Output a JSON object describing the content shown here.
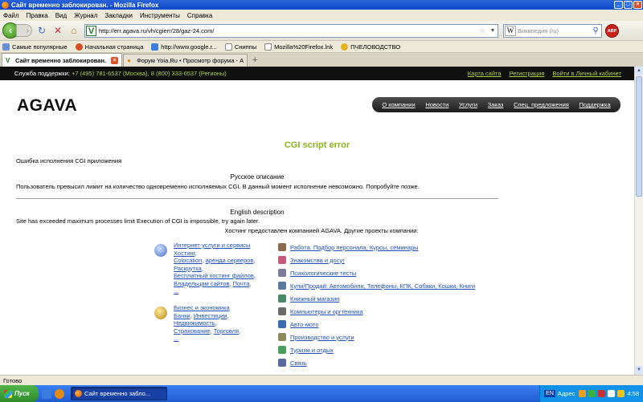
{
  "window": {
    "title": "Сайт временно заблокирован. - Mozilla Firefox"
  },
  "menu": [
    "Файл",
    "Правка",
    "Вид",
    "Журнал",
    "Закладки",
    "Инструменты",
    "Справка"
  ],
  "nav": {
    "url": "http://err.agava.ru/vh/cgierr/28/gaz-24.com/",
    "search_placeholder": "Википедия (ru)",
    "adblock": "ABP"
  },
  "bookmarks": [
    "Самые популярные",
    "Начальная страница",
    "http://www.google.r...",
    "Сниппы",
    "Mozilla%20Firefox.lnk",
    "ПЧЕЛОВОДСТВО"
  ],
  "tabs": [
    {
      "label": "Сайт временно заблокирован.",
      "active": true
    },
    {
      "label": "Форум Yoia.Ru • Просмотр форума - А",
      "active": false
    }
  ],
  "page": {
    "support_label": "Служба поддержки:",
    "support_phones": "+7 (495) 781-6537 (Москва), 8 (800) 333-6537 (Регионы)",
    "support_links": [
      "Карта сайта",
      "Регистрация",
      "Войти в Личный кабинет"
    ],
    "logo": "AGAVA",
    "topnav": [
      "О компании",
      "Новости",
      "Услуги",
      "Заказ",
      "Спец. предложения",
      "Поддержка"
    ],
    "heading": "CGI script error",
    "error_line": "Ошибка исполнения CGI приложения",
    "ru_heading": "Русское описание",
    "ru_text": "Пользователь превысил лимит на количество одновременно исполняемых CGI. В данный момент исполнение невозможно. Попробуйте позже.",
    "en_heading": "English description",
    "en_text": "Site has exceeded maximum processes limit Execution of CGI is impossible, try again later.",
    "hosting_line": "Хостинг предоставлен компанией AGAVA. Другие проекты компании:",
    "cat1": [
      "Интернет-услуги и сервисы",
      "Хостинг",
      "Colocation",
      "аренда серверов",
      "Раскрутка",
      "Бесплатный хостинг файлов",
      "Владельцам сайтов",
      "Почта",
      "..."
    ],
    "cat2": [
      "Бизнес и экономика",
      "Банки",
      "Инвестиции",
      "Недвижимость",
      "Страхование",
      "Торговля",
      "..."
    ],
    "projects": [
      "Работа. Подбор персонала, Курсы, семинары",
      "Знакомства и досуг",
      "Психологические тесты",
      "Купи/Продай: Автомобили, Телефоны, КПК, Собаки, Кошки, Книги",
      "Книжный магазин",
      "Компьютеры и оргтехника",
      "Авто-мото",
      "Производство и услуги",
      "Туризм и отдых",
      "Связь"
    ]
  },
  "status": "Готово",
  "taskbar": {
    "start": "Пуск",
    "task": "Сайт временно забло...",
    "lang": "EN",
    "addr_label": "Адрес",
    "time": "4:58"
  }
}
